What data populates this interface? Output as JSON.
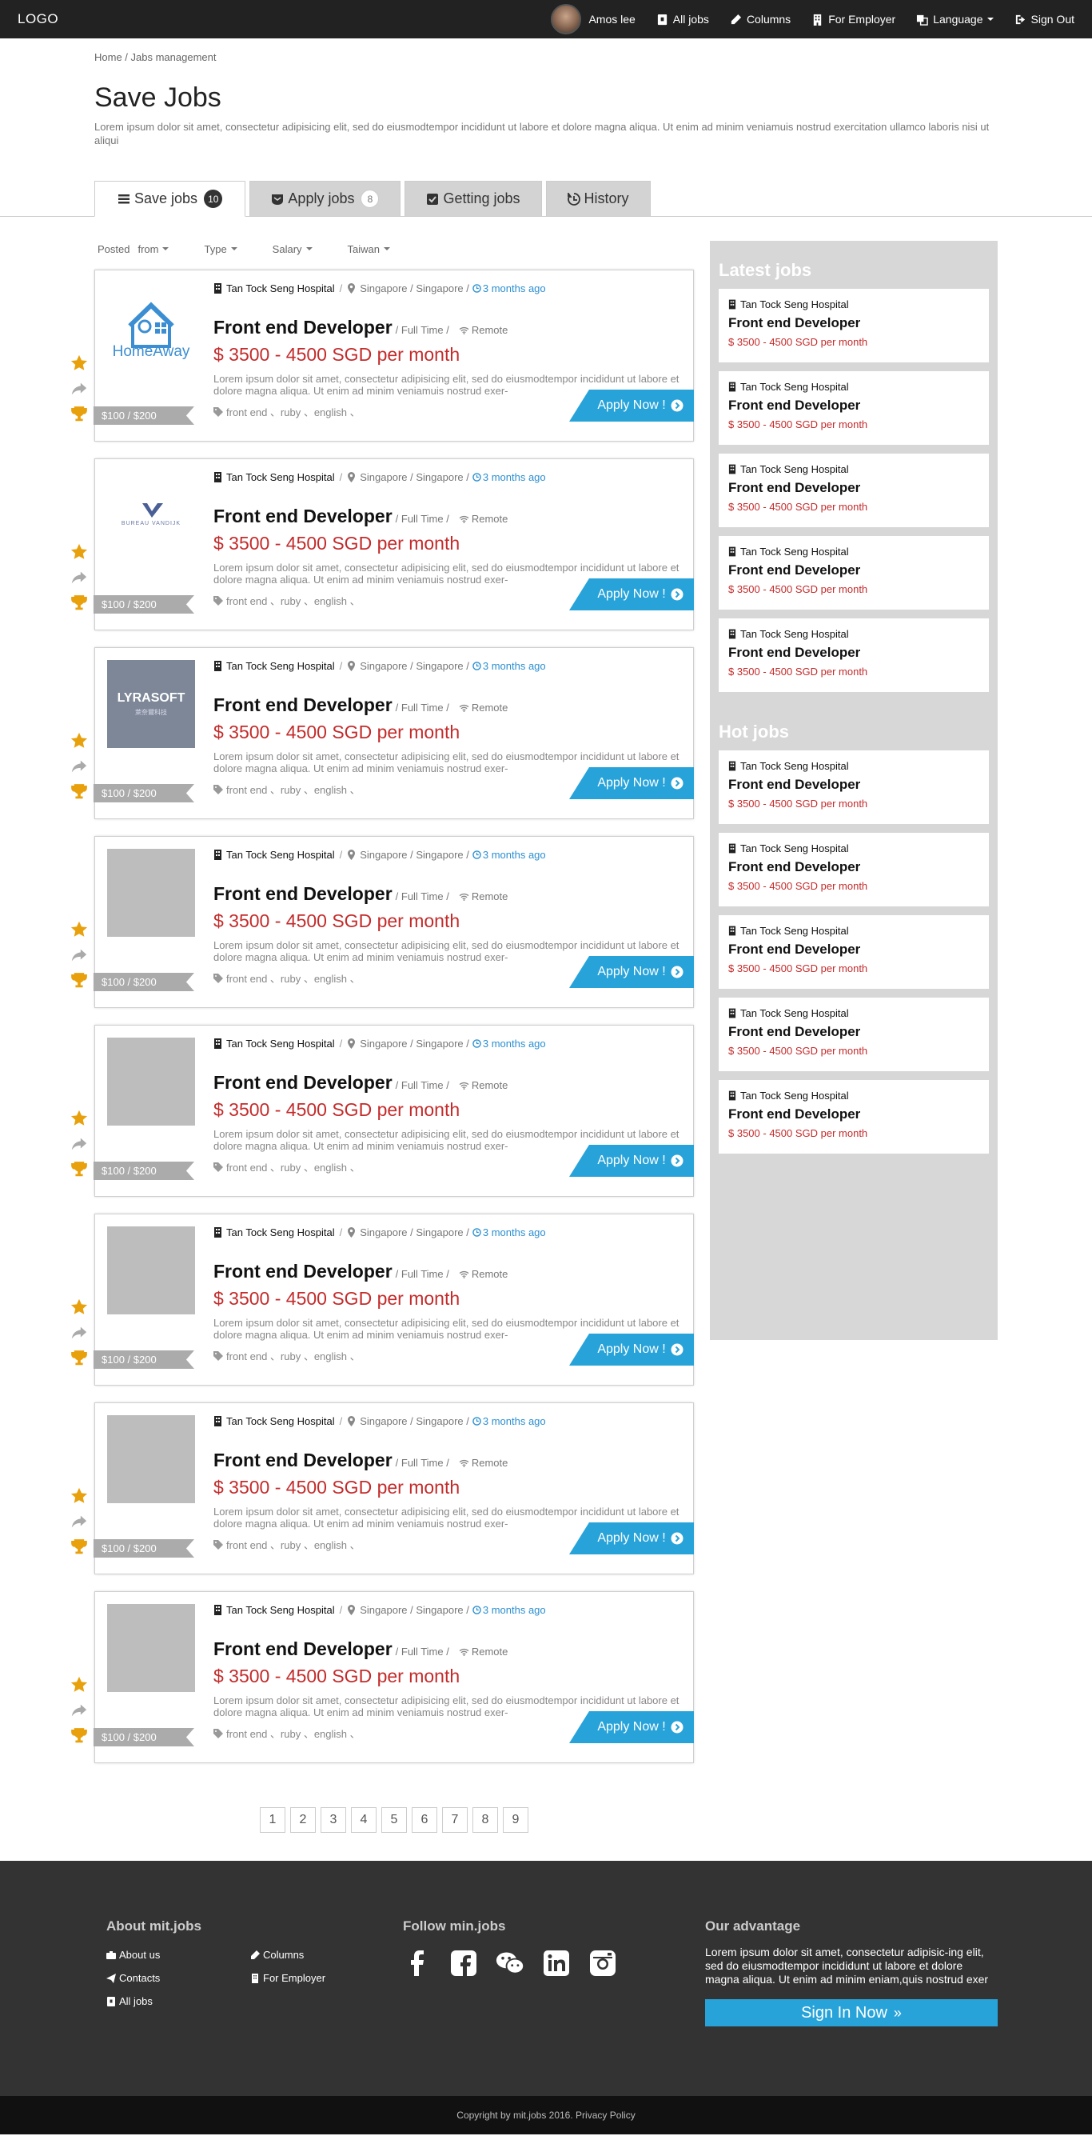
{
  "nav": {
    "logo": "LOGO",
    "user_name": "Amos lee",
    "all_jobs": "All jobs",
    "columns": "Columns",
    "for_employer": "For Employer",
    "language": "Language",
    "sign_out": "Sign Out"
  },
  "breadcrumb": {
    "home": "Home",
    "current": "Jabs management"
  },
  "page": {
    "title": "Save Jobs",
    "description": "Lorem ipsum dolor sit amet, consectetur adipisicing elit, sed do eiusmodtempor incididunt ut labore et dolore magna aliqua. Ut enim ad minim veniamuis nostrud exercitation ullamco laboris nisi ut aliqui"
  },
  "tabs": [
    {
      "label": "Save jobs",
      "count": "10"
    },
    {
      "label": "Apply jobs",
      "count": "8"
    },
    {
      "label": "Getting jobs"
    },
    {
      "label": "History"
    }
  ],
  "filters": {
    "posted": "Posted",
    "from": "from",
    "type": "Type",
    "salary": "Salary",
    "location": "Taiwan"
  },
  "jobs": [
    {
      "logo": "HomeAway",
      "company": "Tan Tock Seng Hospital",
      "location": "Singapore / Singapore /",
      "time": "3 months ago",
      "title": "Front end Developer",
      "type": "/ Full Time /",
      "remote": "Remote",
      "salary": "$ 3500 - 4500  SGD per month",
      "desc": "Lorem ipsum dolor sit amet, consectetur adipisicing elit, sed do eiusmodtempor incididunt ut labore et dolore magna aliqua. Ut enim ad minim veniamuis nostrud exer-",
      "tags": "front end 、ruby 、english 、",
      "price": "$100 / $200",
      "apply": "Apply Now !"
    },
    {
      "logo": "BUREAU VANDIJK",
      "company": "Tan Tock Seng Hospital",
      "location": "Singapore / Singapore /",
      "time": "3 months ago",
      "title": "Front end Developer",
      "type": "/ Full Time /",
      "remote": "Remote",
      "salary": "$ 3500 - 4500  SGD per month",
      "desc": "Lorem ipsum dolor sit amet, consectetur adipisicing elit, sed do eiusmodtempor incididunt ut labore et dolore magna aliqua. Ut enim ad minim veniamuis nostrud exer-",
      "tags": "front end 、ruby 、english 、",
      "price": "$100 / $200",
      "apply": "Apply Now !"
    },
    {
      "logo": "LYRASOFT",
      "logo_sub": "萊奈爾科技",
      "company": "Tan Tock Seng Hospital",
      "location": "Singapore / Singapore /",
      "time": "3 months ago",
      "title": "Front end Developer",
      "type": "/ Full Time /",
      "remote": "Remote",
      "salary": "$ 3500 - 4500  SGD per month",
      "desc": "Lorem ipsum dolor sit amet, consectetur adipisicing elit, sed do eiusmodtempor incididunt ut labore et dolore magna aliqua. Ut enim ad minim veniamuis nostrud exer-",
      "tags": "front end 、ruby 、english 、",
      "price": "$100 / $200",
      "apply": "Apply Now !"
    },
    {
      "company": "Tan Tock Seng Hospital",
      "location": "Singapore / Singapore /",
      "time": "3 months ago",
      "title": "Front end Developer",
      "type": "/ Full Time /",
      "remote": "Remote",
      "salary": "$ 3500 - 4500  SGD per month",
      "desc": "Lorem ipsum dolor sit amet, consectetur adipisicing elit, sed do eiusmodtempor incididunt ut labore et dolore magna aliqua. Ut enim ad minim veniamuis nostrud exer-",
      "tags": "front end 、ruby 、english 、",
      "price": "$100 / $200",
      "apply": "Apply Now !"
    },
    {
      "company": "Tan Tock Seng Hospital",
      "location": "Singapore / Singapore /",
      "time": "3 months ago",
      "title": "Front end Developer",
      "type": "/ Full Time /",
      "remote": "Remote",
      "salary": "$ 3500 - 4500  SGD per month",
      "desc": "Lorem ipsum dolor sit amet, consectetur adipisicing elit, sed do eiusmodtempor incididunt ut labore et dolore magna aliqua. Ut enim ad minim veniamuis nostrud exer-",
      "tags": "front end 、ruby 、english 、",
      "price": "$100 / $200",
      "apply": "Apply Now !"
    },
    {
      "company": "Tan Tock Seng Hospital",
      "location": "Singapore / Singapore /",
      "time": "3 months ago",
      "title": "Front end Developer",
      "type": "/ Full Time /",
      "remote": "Remote",
      "salary": "$ 3500 - 4500  SGD per month",
      "desc": "Lorem ipsum dolor sit amet, consectetur adipisicing elit, sed do eiusmodtempor incididunt ut labore et dolore magna aliqua. Ut enim ad minim veniamuis nostrud exer-",
      "tags": "front end 、ruby 、english 、",
      "price": "$100 / $200",
      "apply": "Apply Now !"
    },
    {
      "company": "Tan Tock Seng Hospital",
      "location": "Singapore / Singapore /",
      "time": "3 months ago",
      "title": "Front end Developer",
      "type": "/ Full Time /",
      "remote": "Remote",
      "salary": "$ 3500 - 4500  SGD per month",
      "desc": "Lorem ipsum dolor sit amet, consectetur adipisicing elit, sed do eiusmodtempor incididunt ut labore et dolore magna aliqua. Ut enim ad minim veniamuis nostrud exer-",
      "tags": "front end 、ruby 、english 、",
      "price": "$100 / $200",
      "apply": "Apply Now !"
    },
    {
      "company": "Tan Tock Seng Hospital",
      "location": "Singapore / Singapore /",
      "time": "3 months ago",
      "title": "Front end Developer",
      "type": "/ Full Time /",
      "remote": "Remote",
      "salary": "$ 3500 - 4500  SGD per month",
      "desc": "Lorem ipsum dolor sit amet, consectetur adipisicing elit, sed do eiusmodtempor incididunt ut labore et dolore magna aliqua. Ut enim ad minim veniamuis nostrud exer-",
      "tags": "front end 、ruby 、english 、",
      "price": "$100 / $200",
      "apply": "Apply Now !"
    }
  ],
  "pagination": [
    "1",
    "2",
    "3",
    "4",
    "5",
    "6",
    "7",
    "8",
    "9"
  ],
  "sidebar": {
    "latest_heading": "Latest jobs",
    "hot_heading": "Hot jobs",
    "latest": [
      {
        "company": "Tan Tock Seng Hospital",
        "title": "Front end Developer",
        "salary": "$ 3500 - 4500 SGD per month"
      },
      {
        "company": "Tan Tock Seng Hospital",
        "title": "Front end Developer",
        "salary": "$ 3500 - 4500 SGD per month"
      },
      {
        "company": "Tan Tock Seng Hospital",
        "title": "Front end Developer",
        "salary": "$ 3500 - 4500 SGD per month"
      },
      {
        "company": "Tan Tock Seng Hospital",
        "title": "Front end Developer",
        "salary": "$ 3500 - 4500 SGD per month"
      },
      {
        "company": "Tan Tock Seng Hospital",
        "title": "Front end Developer",
        "salary": "$ 3500 - 4500 SGD per month"
      }
    ],
    "hot": [
      {
        "company": "Tan Tock Seng Hospital",
        "title": "Front end Developer",
        "salary": "$ 3500 - 4500 SGD per month"
      },
      {
        "company": "Tan Tock Seng Hospital",
        "title": "Front end Developer",
        "salary": "$ 3500 - 4500 SGD per month"
      },
      {
        "company": "Tan Tock Seng Hospital",
        "title": "Front end Developer",
        "salary": "$ 3500 - 4500 SGD per month"
      },
      {
        "company": "Tan Tock Seng Hospital",
        "title": "Front end Developer",
        "salary": "$ 3500 - 4500 SGD per month"
      },
      {
        "company": "Tan Tock Seng Hospital",
        "title": "Front end Developer",
        "salary": "$ 3500 - 4500 SGD per month"
      }
    ]
  },
  "footer": {
    "about_heading": "About mit.jobs",
    "links": {
      "about_us": "About us",
      "columns": "Columns",
      "contacts": "Contacts",
      "for_employer": "For Employer",
      "all_jobs": "All jobs"
    },
    "follow_heading": "Follow min.jobs",
    "advantage_heading": "Our advantage",
    "advantage_text": "Lorem ipsum dolor sit amet, consectetur adipisic-ing elit, sed do eiusmodtempor incididunt ut labore et dolore magna aliqua. Ut enim ad minim eniam,quis nostrud exer",
    "signin": "Sign In Now",
    "copyright": "Copyright by mit.jobs 2016.",
    "privacy": "Privacy Policy"
  },
  "colors": {
    "accent": "#28a3d9",
    "salary": "#c42b2b",
    "star": "#e8a10c",
    "topbar": "#222222",
    "footer": "#333333"
  }
}
